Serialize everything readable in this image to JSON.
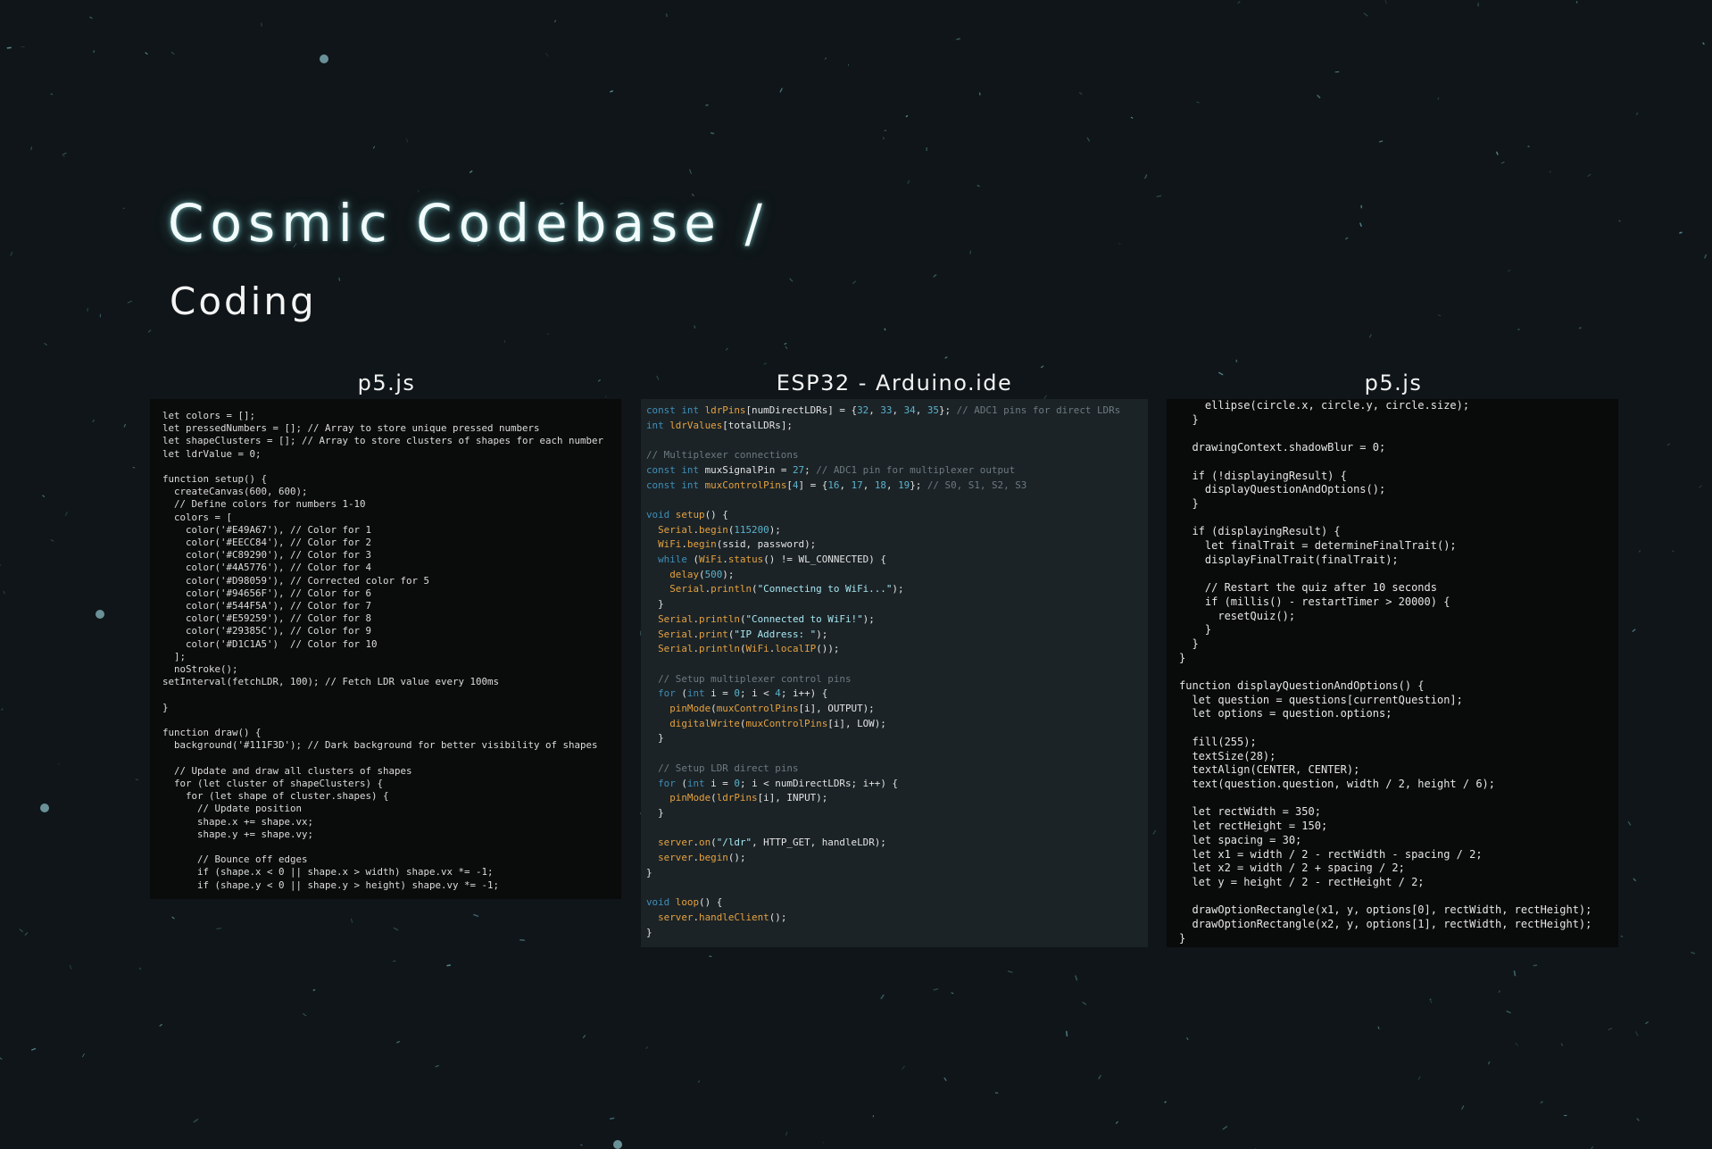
{
  "header": {
    "title": "Cosmic Codebase /",
    "subtitle": "Coding"
  },
  "panels": [
    {
      "label": "p5.js",
      "code": "let colors = [];\nlet pressedNumbers = []; // Array to store unique pressed numbers\nlet shapeClusters = []; // Array to store clusters of shapes for each number\nlet ldrValue = 0;\n\nfunction setup() {\n  createCanvas(600, 600);\n  // Define colors for numbers 1-10\n  colors = [\n    color('#E49A67'), // Color for 1\n    color('#EECC84'), // Color for 2\n    color('#C89290'), // Color for 3\n    color('#4A5776'), // Color for 4\n    color('#D98059'), // Corrected color for 5\n    color('#94656F'), // Color for 6\n    color('#544F5A'), // Color for 7\n    color('#E59259'), // Color for 8\n    color('#29385C'), // Color for 9\n    color('#D1C1A5')  // Color for 10\n  ];\n  noStroke();\nsetInterval(fetchLDR, 100); // Fetch LDR value every 100ms\n\n}\n\nfunction draw() {\n  background('#111F3D'); // Dark background for better visibility of shapes\n\n  // Update and draw all clusters of shapes\n  for (let cluster of shapeClusters) {\n    for (let shape of cluster.shapes) {\n      // Update position\n      shape.x += shape.vx;\n      shape.y += shape.vy;\n\n      // Bounce off edges\n      if (shape.x < 0 || shape.x > width) shape.vx *= -1;\n      if (shape.y < 0 || shape.y > height) shape.vy *= -1;"
    },
    {
      "label": "ESP32 - Arduino.ide",
      "code": "const int ldrPins[numDirectLDRs] = {32, 33, 34, 35}; // ADC1 pins for direct LDRs\nint ldrValues[totalLDRs];\n\n// Multiplexer connections\nconst int muxSignalPin = 27; // ADC1 pin for multiplexer output\nconst int muxControlPins[4] = {16, 17, 18, 19}; // S0, S1, S2, S3\n\nvoid setup() {\n  Serial.begin(115200);\n  WiFi.begin(ssid, password);\n  while (WiFi.status() != WL_CONNECTED) {\n    delay(500);\n    Serial.println(\"Connecting to WiFi...\");\n  }\n  Serial.println(\"Connected to WiFi!\");\n  Serial.print(\"IP Address: \");\n  Serial.println(WiFi.localIP());\n\n  // Setup multiplexer control pins\n  for (int i = 0; i < 4; i++) {\n    pinMode(muxControlPins[i], OUTPUT);\n    digitalWrite(muxControlPins[i], LOW);\n  }\n\n  // Setup LDR direct pins\n  for (int i = 0; i < numDirectLDRs; i++) {\n    pinMode(ldrPins[i], INPUT);\n  }\n\n  server.on(\"/ldr\", HTTP_GET, handleLDR);\n  server.begin();\n}\n\nvoid loop() {\n  server.handleClient();\n}"
    },
    {
      "label": "p5.js",
      "code": "    ellipse(circle.x, circle.y, circle.size);\n  }\n\n  drawingContext.shadowBlur = 0;\n\n  if (!displayingResult) {\n    displayQuestionAndOptions();\n  }\n\n  if (displayingResult) {\n    let finalTrait = determineFinalTrait();\n    displayFinalTrait(finalTrait);\n\n    // Restart the quiz after 10 seconds\n    if (millis() - restartTimer > 20000) {\n      resetQuiz();\n    }\n  }\n}\n\nfunction displayQuestionAndOptions() {\n  let question = questions[currentQuestion];\n  let options = question.options;\n\n  fill(255);\n  textSize(28);\n  textAlign(CENTER, CENTER);\n  text(question.question, width / 2, height / 6);\n\n  let rectWidth = 350;\n  let rectHeight = 150;\n  let spacing = 30;\n  let x1 = width / 2 - rectWidth - spacing / 2;\n  let x2 = width / 2 + spacing / 2;\n  let y = height / 2 - rectHeight / 2;\n\n  drawOptionRectangle(x1, y, options[0], rectWidth, rectHeight);\n  drawOptionRectangle(x2, y, options[1], rectWidth, rectHeight);\n}"
    }
  ]
}
